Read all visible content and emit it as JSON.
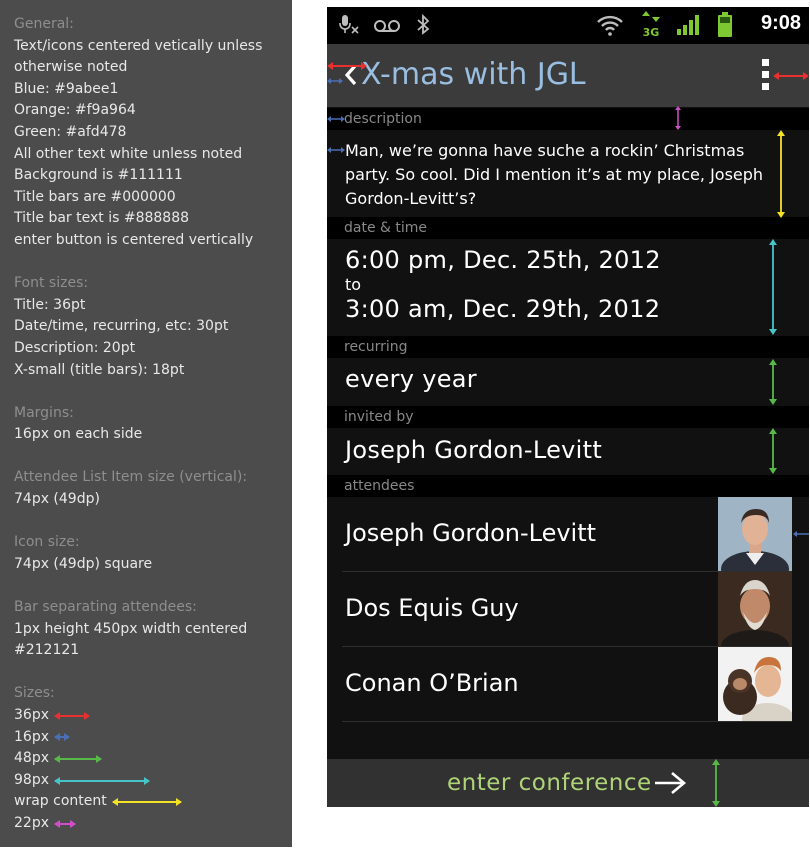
{
  "spec": {
    "general": {
      "heading": "General:",
      "lines": [
        "Text/icons centered vetically unless otherwise noted",
        "Blue: #9abee1",
        "Orange: #f9a964",
        "Green: #afd478",
        "All other text white unless noted",
        "Background is #111111",
        "Title bars are #000000",
        "Title bar text is #888888",
        "enter button is centered vertically"
      ]
    },
    "font_sizes": {
      "heading": "Font sizes:",
      "lines": [
        "Title: 36pt",
        "Date/time, recurring, etc: 30pt",
        "Description: 20pt",
        "X-small (title bars): 18pt"
      ]
    },
    "margins": {
      "heading": "Margins:",
      "lines": [
        "16px on each side"
      ]
    },
    "attendee_item": {
      "heading": "Attendee List Item size (vertical):",
      "lines": [
        "74px (49dp)"
      ]
    },
    "icon_size": {
      "heading": "Icon size:",
      "lines": [
        "74px (49dp) square"
      ]
    },
    "separator": {
      "heading": "Bar separating attendees:",
      "lines": [
        "1px height 450px width centered",
        "#212121"
      ]
    },
    "sizes": {
      "heading": "Sizes:",
      "items": [
        {
          "label": "36px",
          "color": "#e8302f"
        },
        {
          "label": "16px",
          "color": "#4a6fb5"
        },
        {
          "label": "48px",
          "color": "#58b848"
        },
        {
          "label": "98px",
          "color": "#46c4c8"
        },
        {
          "label": "wrap content",
          "color": "#f5e224"
        },
        {
          "label": "22px",
          "color": "#d04fc8"
        }
      ]
    }
  },
  "colors": {
    "blue": "#9abee1",
    "orange": "#f9a964",
    "green": "#afd478",
    "background": "#111111",
    "title_bar": "#000000",
    "title_bar_text": "#888888",
    "separator": "#212121"
  },
  "status_bar": {
    "time": "9:08",
    "icons": [
      "mic-muted-icon",
      "voicemail-icon",
      "bluetooth-icon",
      "wifi-icon",
      "3g-data-icon",
      "signal-icon",
      "battery-icon"
    ],
    "network_label": "3G"
  },
  "header": {
    "title": "X-mas with JGL",
    "back_icon": "back-chevron-icon",
    "menu_icon": "overflow-menu-icon"
  },
  "description": {
    "label": "description",
    "text": "Man, we’re gonna have suche a rockin’ Christmas party. So cool. Did I mention it’s at my place, Joseph Gordon-Levitt’s?"
  },
  "date_time": {
    "label": "date & time",
    "start": "6:00 pm, Dec. 25th, 2012",
    "to": "to",
    "end": "3:00 am, Dec. 29th, 2012"
  },
  "recurring": {
    "label": "recurring",
    "value": "every year"
  },
  "invited_by": {
    "label": "invited by",
    "value": "Joseph Gordon-Levitt"
  },
  "attendees": {
    "label": "attendees",
    "items": [
      {
        "name": "Joseph Gordon-Levitt"
      },
      {
        "name": "Dos Equis Guy"
      },
      {
        "name": "Conan O’Brian"
      }
    ]
  },
  "enter_button": {
    "label": "enter conference",
    "icon": "arrow-right-icon"
  }
}
